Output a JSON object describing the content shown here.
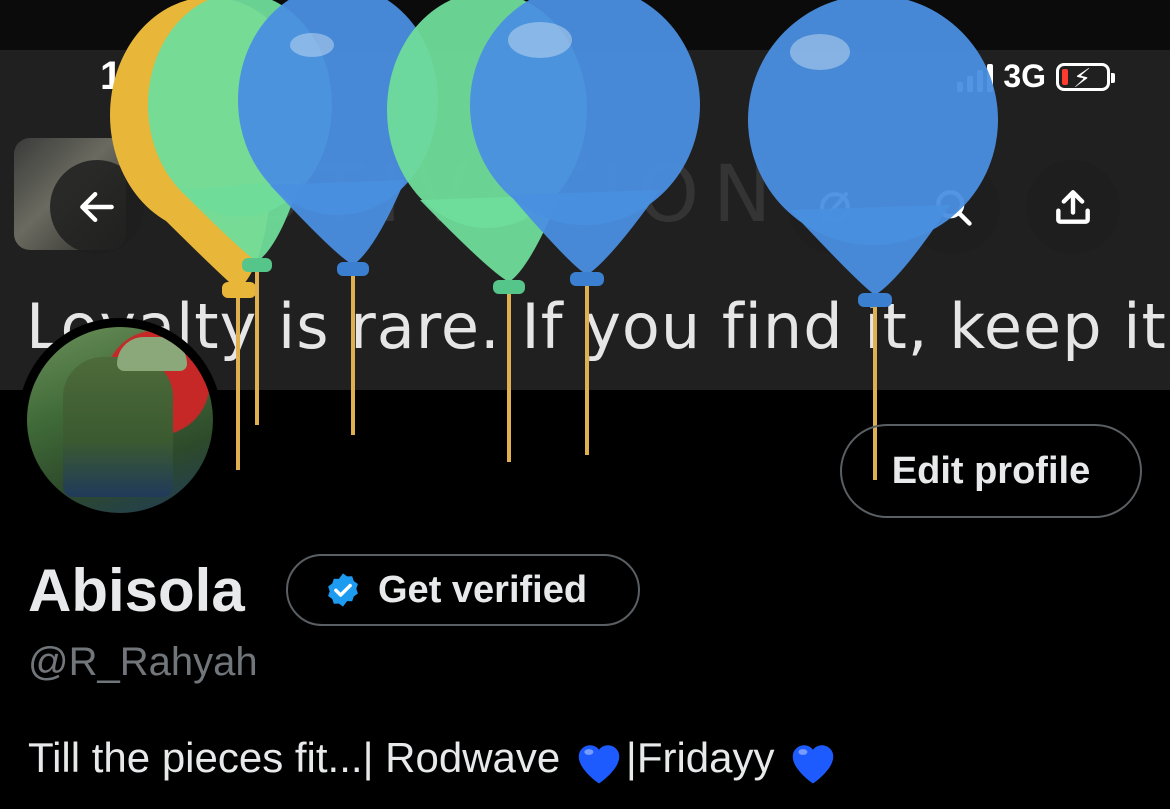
{
  "status_bar": {
    "time": "15:01",
    "network": "3G"
  },
  "header": {
    "banner_quote": "Loyalty is rare. If you find it, keep it.",
    "banner_watermark": "MOTIVATION",
    "icons": {
      "back": "arrow-left-icon",
      "hide": "eye-slash-icon",
      "search": "search-icon",
      "share": "share-icon"
    }
  },
  "profile": {
    "name": "Abisola",
    "verify_label": "Get verified",
    "handle": "@R_Rahyah",
    "edit_label": "Edit profile",
    "bio_parts": [
      "Till the pieces fit...| Rodwave ",
      "|Fridayy"
    ]
  },
  "colors": {
    "verified_badge": "#1d9bf0",
    "heart": "#1e5bff",
    "balloon_blue": "#4a8fe0",
    "balloon_green": "#6fdc9a",
    "balloon_yellow": "#e8b73a"
  }
}
